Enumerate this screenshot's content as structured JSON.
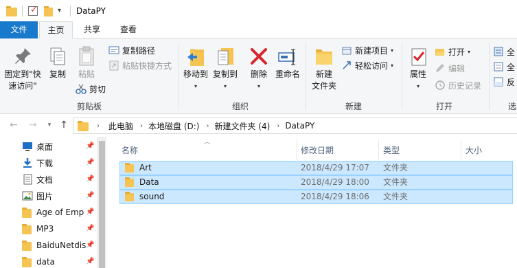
{
  "window": {
    "title": "DataPY"
  },
  "ribbon_tabs": {
    "file": "文件",
    "home": "主页",
    "share": "共享",
    "view": "查看"
  },
  "clipboard": {
    "pin_label_1": "固定到\"快",
    "pin_label_2": "速访问\"",
    "copy": "复制",
    "paste": "粘贴",
    "copy_path": "复制路径",
    "paste_shortcut": "粘贴快捷方式",
    "cut": "剪切",
    "group": "剪贴板"
  },
  "organize": {
    "move_to": "移动到",
    "copy_to": "复制到",
    "delete": "删除",
    "rename": "重命名",
    "group": "组织"
  },
  "new": {
    "new_folder_1": "新建",
    "new_folder_2": "文件夹",
    "new_item": "新建项目",
    "easy_access": "轻松访问",
    "group": "新建"
  },
  "open": {
    "properties": "属性",
    "open": "打开",
    "edit": "编辑",
    "history": "历史记录",
    "group": "打开"
  },
  "select": {
    "select_all": "全",
    "select_none": "全",
    "invert": "反",
    "group": "选"
  },
  "breadcrumb": [
    "此电脑",
    "本地磁盘 (D:)",
    "新建文件夹 (4)",
    "DataPY"
  ],
  "navpane": {
    "items": [
      {
        "label": "桌面",
        "icon": "desktop-icon",
        "color": "#1e6fc6"
      },
      {
        "label": "下载",
        "icon": "download-icon",
        "color": "#1e6fc6"
      },
      {
        "label": "文档",
        "icon": "document-icon",
        "color": "#555555"
      },
      {
        "label": "图片",
        "icon": "pictures-icon",
        "color": "#555555"
      },
      {
        "label": "Age of Emp",
        "icon": "folder-icon",
        "color": "#f5c453"
      },
      {
        "label": "MP3",
        "icon": "folder-icon",
        "color": "#f5c453"
      },
      {
        "label": "BaiduNetdis",
        "icon": "folder-icon",
        "color": "#f5c453"
      },
      {
        "label": "data",
        "icon": "folder-icon",
        "color": "#f5c453"
      }
    ]
  },
  "columns": {
    "name": "名称",
    "date": "修改日期",
    "type": "类型",
    "size": "大小"
  },
  "files": [
    {
      "name": "Art",
      "date": "2018/4/29 17:07",
      "type": "文件夹"
    },
    {
      "name": "Data",
      "date": "2018/4/29 18:00",
      "type": "文件夹"
    },
    {
      "name": "sound",
      "date": "2018/4/29 18:06",
      "type": "文件夹"
    }
  ],
  "colors": {
    "accent": "#1979ca",
    "selection": "#cce8ff",
    "selection_border": "#99d1ff",
    "folder": "#f5c453"
  }
}
